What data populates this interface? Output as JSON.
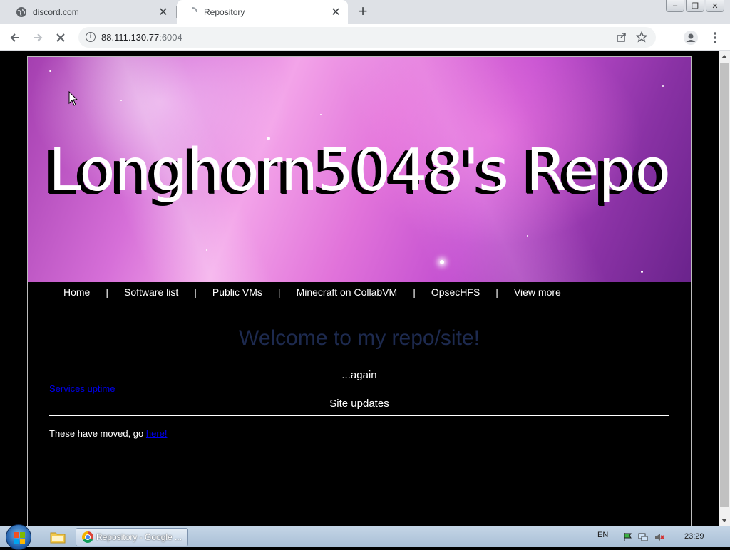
{
  "browser": {
    "tabs": [
      {
        "title": "discord.com",
        "active": false
      },
      {
        "title": "Repository",
        "active": true
      }
    ],
    "new_tab_symbol": "+",
    "url_host": "88.111.130.77",
    "url_port": ":6004",
    "window_controls": {
      "minimize": "‒",
      "restore": "❐",
      "close": "✕"
    }
  },
  "site": {
    "banner_title": "Longhorn5048's Repo",
    "nav": [
      {
        "label": "Home"
      },
      {
        "label": "Software list"
      },
      {
        "label": "Public VMs"
      },
      {
        "label": "Minecraft on CollabVM"
      },
      {
        "label": "OpsecHFS"
      },
      {
        "label": "View more"
      }
    ],
    "nav_separator": "|",
    "welcome": "Welcome to my repo/site!",
    "again": "...again",
    "service_link": "Services uptime",
    "site_updates_heading": "Site updates",
    "moved_text": "These have moved, go ",
    "moved_link": "here!"
  },
  "taskbar": {
    "task_label": "Repository - Google ...",
    "language": "EN",
    "clock": "23:29"
  },
  "colors": {
    "welcome_text": "#1d2a4f",
    "link": "#0000ee",
    "page_bg": "#000000"
  }
}
